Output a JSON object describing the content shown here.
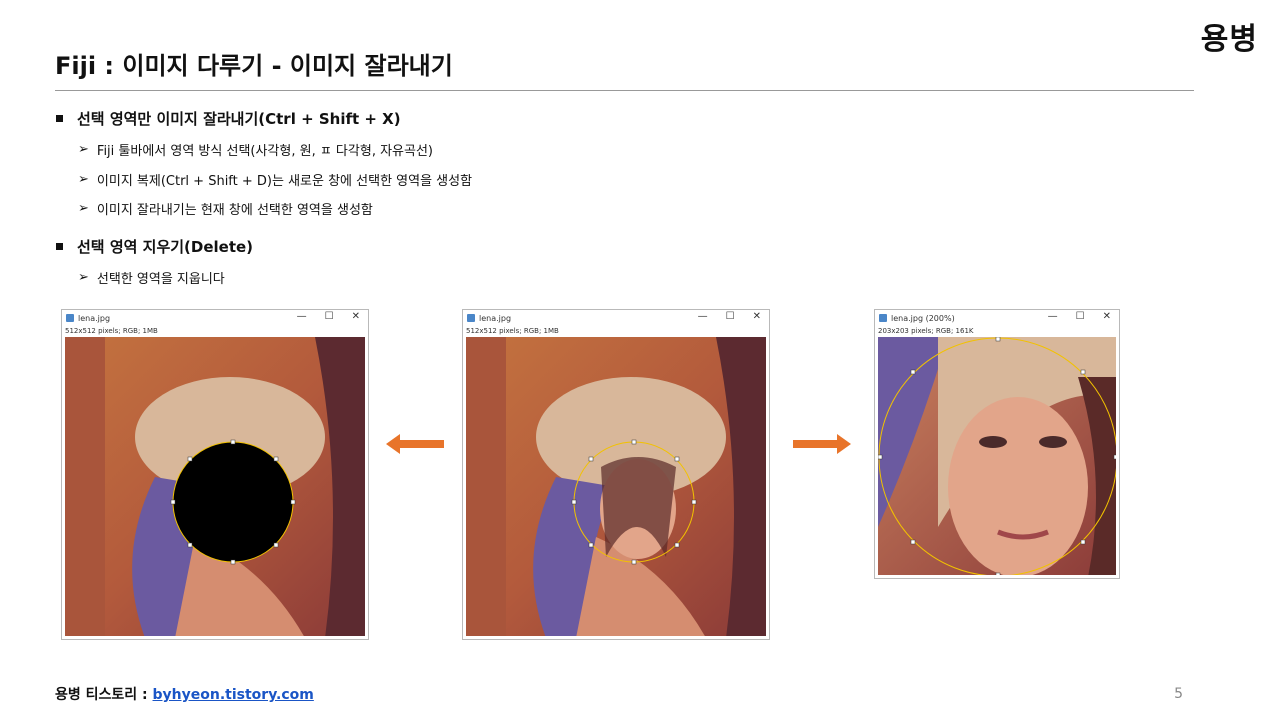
{
  "brand": "용병",
  "title": "Fiji : 이미지 다루기 - 이미지 잘라내기",
  "sections": [
    {
      "heading": "선택 영역만 이미지 잘라내기(Ctrl + Shift + X)",
      "items": [
        "Fiji 툴바에서 영역 방식 선택(사각형, 원, ㅍ 다각형, 자유곡선)",
        "이미지 복제(Ctrl + Shift + D)는 새로운 창에 선택한 영역을 생성함",
        "이미지 잘라내기는 현재 창에 선택한 영역을 생성함"
      ]
    },
    {
      "heading": "선택 영역 지우기(Delete)",
      "items": [
        "선택한 영역을 지웁니다"
      ]
    }
  ],
  "windows": [
    {
      "title": "lena.jpg",
      "info": "512x512 pixels; RGB; 1MB"
    },
    {
      "title": "lena.jpg",
      "info": "512x512 pixels; RGB; 1MB"
    },
    {
      "title": "lena.jpg (200%)",
      "info": "203x203 pixels; RGB; 161K"
    }
  ],
  "window_controls": {
    "minimize": "—",
    "maximize": "☐",
    "close": "✕"
  },
  "footer": {
    "label": "용병 티스토리 : ",
    "link": "byhyeon.tistory.com"
  },
  "page_number": "5",
  "colors": {
    "arrow": "#e8742a",
    "selection": "#f2c200",
    "link": "#1a55c6"
  }
}
